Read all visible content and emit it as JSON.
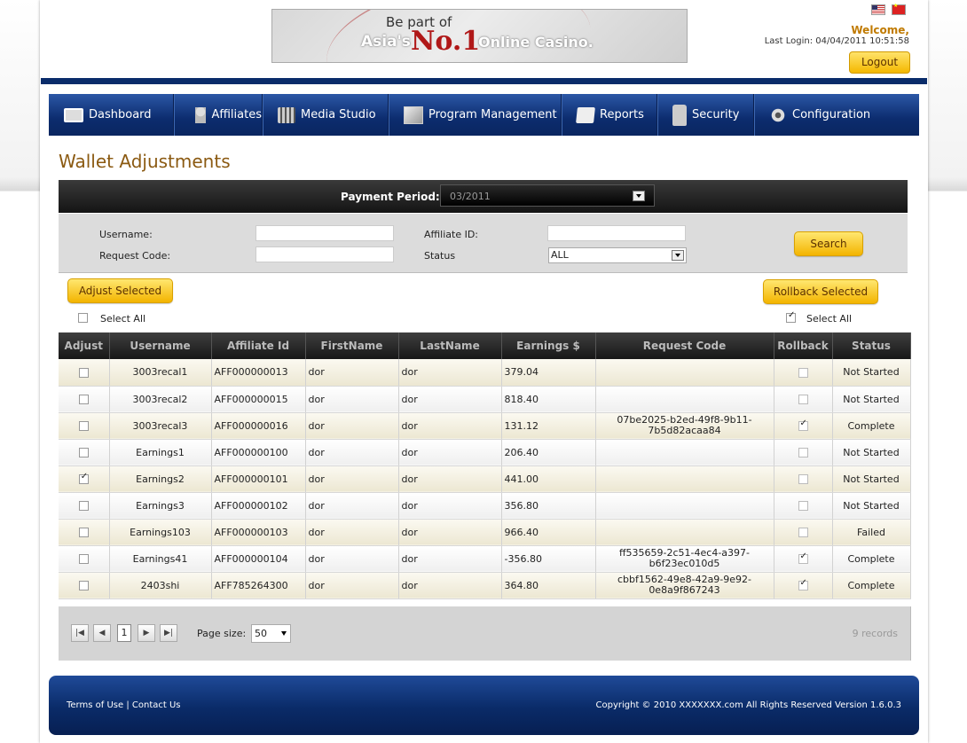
{
  "header": {
    "banner": {
      "line1": "Be part of",
      "line2_a": "Asia's",
      "line2_b": "No.1",
      "line2_c": "Online Casino."
    },
    "welcome": "Welcome,",
    "last_login": "Last Login: 04/04/2011 10:51:58",
    "logout_label": "Logout"
  },
  "nav": {
    "items": [
      {
        "label": "Dashboard",
        "icon": "dashboard-icon"
      },
      {
        "label": "Affiliates",
        "icon": "affiliates-icon"
      },
      {
        "label": "Media Studio",
        "icon": "media-studio-icon"
      },
      {
        "label": "Program Management",
        "icon": "program-management-icon"
      },
      {
        "label": "Reports",
        "icon": "reports-icon"
      },
      {
        "label": "Security",
        "icon": "lock-icon"
      },
      {
        "label": "Configuration",
        "icon": "gear-icon"
      }
    ]
  },
  "page_title": "Wallet Adjustments",
  "period": {
    "label": "Payment Period:",
    "value": "03/2011"
  },
  "filter": {
    "username_label": "Username:",
    "request_code_label": "Request Code:",
    "affiliate_id_label": "Affiliate ID:",
    "status_label": "Status",
    "status_value": "ALL",
    "search_label": "Search"
  },
  "actions": {
    "adjust_selected": "Adjust Selected",
    "rollback_selected": "Rollback Selected",
    "select_all_left": "Select All",
    "select_all_right": "Select All"
  },
  "table": {
    "columns": [
      "Adjust",
      "Username",
      "Affiliate Id",
      "FirstName",
      "LastName",
      "Earnings $",
      "Request Code",
      "Rollback",
      "Status"
    ],
    "rows": [
      {
        "adjust": false,
        "username": "3003recal1",
        "affiliate_id": "AFF000000013",
        "first": "dor",
        "last": "dor",
        "earnings": "379.04",
        "request_code": "",
        "rollback": false,
        "status": "Not Started"
      },
      {
        "adjust": false,
        "username": "3003recal2",
        "affiliate_id": "AFF000000015",
        "first": "dor",
        "last": "dor",
        "earnings": "818.40",
        "request_code": "",
        "rollback": false,
        "status": "Not Started"
      },
      {
        "adjust": false,
        "username": "3003recal3",
        "affiliate_id": "AFF000000016",
        "first": "dor",
        "last": "dor",
        "earnings": "131.12",
        "request_code": "07be2025-b2ed-49f8-9b11-7b5d82acaa84",
        "rollback": true,
        "status": "Complete"
      },
      {
        "adjust": false,
        "username": "Earnings1",
        "affiliate_id": "AFF000000100",
        "first": "dor",
        "last": "dor",
        "earnings": "206.40",
        "request_code": "",
        "rollback": false,
        "status": "Not Started"
      },
      {
        "adjust": true,
        "username": "Earnings2",
        "affiliate_id": "AFF000000101",
        "first": "dor",
        "last": "dor",
        "earnings": "441.00",
        "request_code": "",
        "rollback": false,
        "status": "Not Started"
      },
      {
        "adjust": false,
        "username": "Earnings3",
        "affiliate_id": "AFF000000102",
        "first": "dor",
        "last": "dor",
        "earnings": "356.80",
        "request_code": "",
        "rollback": false,
        "status": "Not Started"
      },
      {
        "adjust": false,
        "username": "Earnings103",
        "affiliate_id": "AFF000000103",
        "first": "dor",
        "last": "dor",
        "earnings": "966.40",
        "request_code": "",
        "rollback": false,
        "status": "Failed"
      },
      {
        "adjust": false,
        "username": "Earnings41",
        "affiliate_id": "AFF000000104",
        "first": "dor",
        "last": "dor",
        "earnings": "-356.80",
        "request_code": "ff535659-2c51-4ec4-a397-b6f23ec010d5",
        "rollback": true,
        "status": "Complete"
      },
      {
        "adjust": false,
        "username": "2403shi",
        "affiliate_id": "AFF785264300",
        "first": "dor",
        "last": "dor",
        "earnings": "364.80",
        "request_code": "cbbf1562-49e8-42a9-9e92-0e8a9f867243",
        "rollback": true,
        "status": "Complete"
      }
    ]
  },
  "pager": {
    "current_page": "1",
    "page_size_label": "Page size:",
    "page_size_value": "50",
    "records": "9 records"
  },
  "footer": {
    "terms": "Terms of Use",
    "separator": "|",
    "contact": "Contact Us",
    "copyright": "Copyright © 2010 XXXXXXX.com All Rights Reserved  Version 1.6.0.3"
  }
}
